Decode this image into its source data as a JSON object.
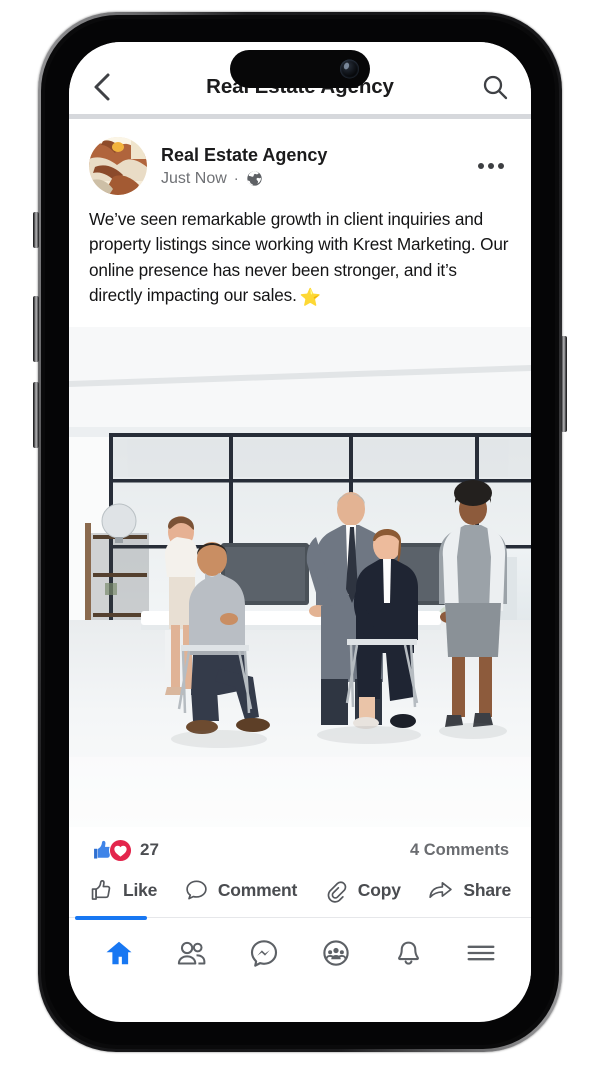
{
  "app": {
    "header": {
      "title": "Real Estate Agency",
      "back_icon": "chevron-left-icon",
      "search_icon": "search-icon"
    }
  },
  "post": {
    "author": "Real Estate Agency",
    "timestamp": "Just Now",
    "separator": "·",
    "privacy_icon": "globe-icon",
    "more_icon": "more-options-icon",
    "body": "We’ve seen remarkable growth in client inquiries and property listings since working with Krest Marketing. Our online presence has never been stronger, and it’s directly impacting our sales.",
    "body_emoji": "⭐",
    "avatar_alt": "handshake-photo",
    "image_alt": "business-team-in-bright-office"
  },
  "engagement": {
    "reaction_icons": [
      "like-reaction-icon",
      "love-reaction-icon"
    ],
    "reaction_count": "27",
    "comments_label": "4 Comments"
  },
  "actions": [
    {
      "label": "Like",
      "icon": "thumbs-up-icon"
    },
    {
      "label": "Comment",
      "icon": "comment-bubble-icon"
    },
    {
      "label": "Copy",
      "icon": "link-paperclip-icon"
    },
    {
      "label": "Share",
      "icon": "share-arrow-icon"
    }
  ],
  "bottom_nav": {
    "active_index": 0,
    "items": [
      {
        "name": "home",
        "icon": "home-icon"
      },
      {
        "name": "friends",
        "icon": "friends-icon"
      },
      {
        "name": "messenger",
        "icon": "messenger-icon"
      },
      {
        "name": "groups",
        "icon": "groups-icon"
      },
      {
        "name": "notifications",
        "icon": "bell-icon"
      },
      {
        "name": "menu",
        "icon": "hamburger-menu-icon"
      }
    ]
  },
  "colors": {
    "accent": "#1877f2",
    "like": "#1877f2",
    "love": "#e3254c",
    "star": "#f7b731",
    "text": "#141415",
    "muted": "#6f7175"
  }
}
